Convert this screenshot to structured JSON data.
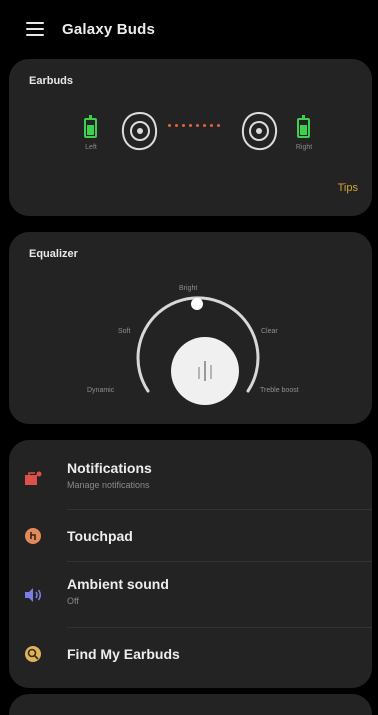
{
  "app": {
    "title": "Galaxy Buds"
  },
  "earbuds": {
    "title": "Earbuds",
    "left_battery_label": "Left",
    "right_battery_label": "Right",
    "left_battery_level": 0.75,
    "right_battery_level": 0.75,
    "tips_label": "Tips",
    "battery_color": "#3fcf4e",
    "connection_color": "#e0663a",
    "link_color": "#d4a531"
  },
  "equalizer": {
    "title": "Equalizer",
    "presets": {
      "top": "Bright",
      "left": "Soft",
      "right": "Clear",
      "bottom_left": "Dynamic",
      "bottom_right": "Treble boost"
    }
  },
  "menu": {
    "items": [
      {
        "title": "Notifications",
        "subtitle": "Manage notifications",
        "icon": "notifications-icon",
        "icon_color": "#e0504a"
      },
      {
        "title": "Touchpad",
        "subtitle": "",
        "icon": "touchpad-icon",
        "icon_color": "#e08a5a"
      },
      {
        "title": "Ambient sound",
        "subtitle": "Off",
        "icon": "ambient-sound-icon",
        "icon_color": "#7d7de6"
      },
      {
        "title": "Find My Earbuds",
        "subtitle": "",
        "icon": "find-earbuds-icon",
        "icon_color": "#e0b25a"
      }
    ]
  }
}
